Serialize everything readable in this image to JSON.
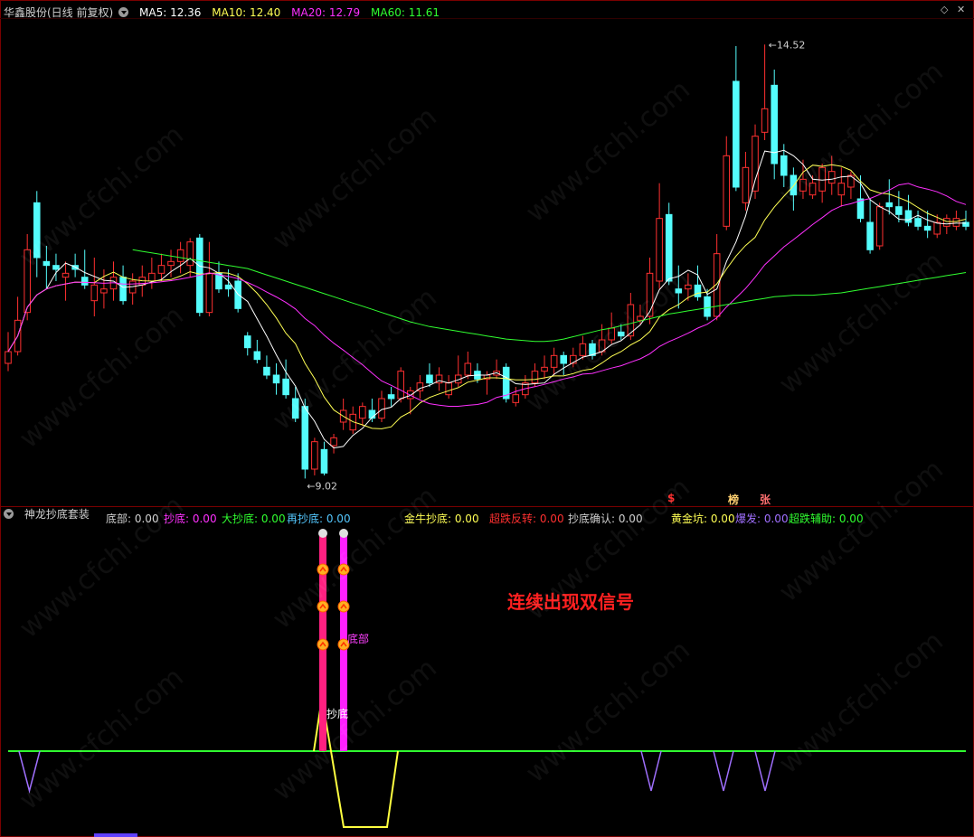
{
  "header": {
    "title": "华鑫股份(日线 前复权)",
    "ma5": "MA5: 12.36",
    "ma10": "MA10: 12.40",
    "ma20": "MA20: 12.79",
    "ma60": "MA60: 11.61"
  },
  "colors": {
    "up": "#ff3030",
    "down": "#54fcfc",
    "ma5": "#ffffff",
    "ma10": "#ffff54",
    "ma20": "#ff30ff",
    "ma60": "#30ff30",
    "grid": "#7a0000"
  },
  "main_annotations": {
    "high_label": "14.52",
    "low_label": "9.02"
  },
  "tags": {
    "dollar": "$",
    "bang": "榜",
    "zhang": "张"
  },
  "indicator": {
    "name": "神龙抄底套装",
    "dibu": "底部: 0.00",
    "chaodi": "抄底: 0.00",
    "dachaodi": "大抄底: 0.00",
    "zaichaodi": "再抄底: 0.00",
    "jinniu": "金牛抄底: 0.00",
    "chaodiefanzhuan": "超跌反转: 0.00",
    "chaodiquerren": "抄底确认: 0.00",
    "huangjinkeng": "黄金坑: 0.00",
    "baofa": "爆发: 0.00",
    "chaodiefuzhu": "超跌辅助: 0.00",
    "label_chaodi": "抄底",
    "label_dibu": "底部"
  },
  "note": "连续出现双信号",
  "watermark": "www.cfchi.com",
  "chart_data": {
    "type": "candlestick",
    "title": "华鑫股份(日线 前复权)",
    "ylim": [
      8.8,
      14.8
    ],
    "candles": [
      {
        "o": 10.45,
        "h": 10.85,
        "l": 10.35,
        "c": 10.6
      },
      {
        "o": 10.6,
        "h": 11.3,
        "l": 10.55,
        "c": 11.0
      },
      {
        "o": 11.1,
        "h": 12.1,
        "l": 11.0,
        "c": 11.9
      },
      {
        "o": 12.5,
        "h": 12.65,
        "l": 11.55,
        "c": 11.8
      },
      {
        "o": 11.75,
        "h": 11.95,
        "l": 11.4,
        "c": 11.7
      },
      {
        "o": 11.7,
        "h": 11.85,
        "l": 11.5,
        "c": 11.65
      },
      {
        "o": 11.55,
        "h": 11.75,
        "l": 11.25,
        "c": 11.6
      },
      {
        "o": 11.7,
        "h": 11.85,
        "l": 11.55,
        "c": 11.65
      },
      {
        "o": 11.55,
        "h": 11.9,
        "l": 11.4,
        "c": 11.45
      },
      {
        "o": 11.25,
        "h": 11.8,
        "l": 11.05,
        "c": 11.45
      },
      {
        "o": 11.35,
        "h": 11.65,
        "l": 11.15,
        "c": 11.4
      },
      {
        "o": 11.4,
        "h": 11.75,
        "l": 11.25,
        "c": 11.55
      },
      {
        "o": 11.55,
        "h": 11.7,
        "l": 11.2,
        "c": 11.25
      },
      {
        "o": 11.35,
        "h": 11.6,
        "l": 11.2,
        "c": 11.5
      },
      {
        "o": 11.45,
        "h": 11.7,
        "l": 11.3,
        "c": 11.55
      },
      {
        "o": 11.5,
        "h": 11.8,
        "l": 11.4,
        "c": 11.6
      },
      {
        "o": 11.6,
        "h": 11.85,
        "l": 11.5,
        "c": 11.7
      },
      {
        "o": 11.7,
        "h": 11.9,
        "l": 11.55,
        "c": 11.75
      },
      {
        "o": 11.75,
        "h": 12.0,
        "l": 11.6,
        "c": 11.9
      },
      {
        "o": 11.7,
        "h": 12.05,
        "l": 11.55,
        "c": 12.0
      },
      {
        "o": 12.05,
        "h": 12.1,
        "l": 11.05,
        "c": 11.1
      },
      {
        "o": 11.1,
        "h": 12.0,
        "l": 11.05,
        "c": 11.6
      },
      {
        "o": 11.6,
        "h": 11.75,
        "l": 11.35,
        "c": 11.4
      },
      {
        "o": 11.45,
        "h": 11.65,
        "l": 11.3,
        "c": 11.4
      },
      {
        "o": 11.5,
        "h": 11.6,
        "l": 11.1,
        "c": 11.15
      },
      {
        "o": 10.8,
        "h": 10.85,
        "l": 10.55,
        "c": 10.65
      },
      {
        "o": 10.6,
        "h": 10.75,
        "l": 10.45,
        "c": 10.5
      },
      {
        "o": 10.4,
        "h": 10.55,
        "l": 10.25,
        "c": 10.3
      },
      {
        "o": 10.3,
        "h": 10.45,
        "l": 10.05,
        "c": 10.2
      },
      {
        "o": 10.25,
        "h": 10.5,
        "l": 10.0,
        "c": 10.05
      },
      {
        "o": 10.0,
        "h": 10.15,
        "l": 9.7,
        "c": 9.75
      },
      {
        "o": 9.9,
        "h": 10.0,
        "l": 8.98,
        "c": 9.1
      },
      {
        "o": 9.1,
        "h": 9.5,
        "l": 9.02,
        "c": 9.45
      },
      {
        "o": 9.35,
        "h": 9.45,
        "l": 9.02,
        "c": 9.05
      },
      {
        "o": 9.4,
        "h": 9.55,
        "l": 9.3,
        "c": 9.5
      },
      {
        "o": 9.7,
        "h": 10.0,
        "l": 9.6,
        "c": 9.85
      },
      {
        "o": 9.6,
        "h": 9.9,
        "l": 9.55,
        "c": 9.8
      },
      {
        "o": 9.75,
        "h": 9.95,
        "l": 9.65,
        "c": 9.9
      },
      {
        "o": 9.85,
        "h": 10.0,
        "l": 9.7,
        "c": 9.75
      },
      {
        "o": 9.75,
        "h": 10.1,
        "l": 9.7,
        "c": 10.0
      },
      {
        "o": 10.05,
        "h": 10.15,
        "l": 9.9,
        "c": 10.0
      },
      {
        "o": 10.0,
        "h": 10.4,
        "l": 9.95,
        "c": 10.35
      },
      {
        "o": 10.0,
        "h": 10.15,
        "l": 9.8,
        "c": 10.1
      },
      {
        "o": 10.1,
        "h": 10.3,
        "l": 10.0,
        "c": 10.2
      },
      {
        "o": 10.3,
        "h": 10.45,
        "l": 10.15,
        "c": 10.2
      },
      {
        "o": 10.2,
        "h": 10.4,
        "l": 10.1,
        "c": 10.3
      },
      {
        "o": 10.05,
        "h": 10.3,
        "l": 10.0,
        "c": 10.2
      },
      {
        "o": 10.2,
        "h": 10.55,
        "l": 10.15,
        "c": 10.3
      },
      {
        "o": 10.3,
        "h": 10.6,
        "l": 10.25,
        "c": 10.45
      },
      {
        "o": 10.35,
        "h": 10.45,
        "l": 10.2,
        "c": 10.25
      },
      {
        "o": 10.25,
        "h": 10.35,
        "l": 10.05,
        "c": 10.3
      },
      {
        "o": 10.3,
        "h": 10.5,
        "l": 10.25,
        "c": 10.35
      },
      {
        "o": 10.4,
        "h": 10.45,
        "l": 9.95,
        "c": 10.0
      },
      {
        "o": 9.95,
        "h": 10.15,
        "l": 9.9,
        "c": 10.05
      },
      {
        "o": 10.05,
        "h": 10.3,
        "l": 10.0,
        "c": 10.2
      },
      {
        "o": 10.2,
        "h": 10.45,
        "l": 10.15,
        "c": 10.35
      },
      {
        "o": 10.35,
        "h": 10.55,
        "l": 10.25,
        "c": 10.4
      },
      {
        "o": 10.4,
        "h": 10.65,
        "l": 10.3,
        "c": 10.55
      },
      {
        "o": 10.55,
        "h": 10.6,
        "l": 10.3,
        "c": 10.45
      },
      {
        "o": 10.45,
        "h": 10.65,
        "l": 10.4,
        "c": 10.55
      },
      {
        "o": 10.55,
        "h": 10.8,
        "l": 10.5,
        "c": 10.7
      },
      {
        "o": 10.7,
        "h": 10.75,
        "l": 10.5,
        "c": 10.55
      },
      {
        "o": 10.6,
        "h": 10.95,
        "l": 10.55,
        "c": 10.75
      },
      {
        "o": 10.75,
        "h": 11.1,
        "l": 10.7,
        "c": 10.9
      },
      {
        "o": 10.85,
        "h": 10.95,
        "l": 10.75,
        "c": 10.8
      },
      {
        "o": 10.8,
        "h": 11.35,
        "l": 10.75,
        "c": 11.2
      },
      {
        "o": 11.0,
        "h": 11.2,
        "l": 10.95,
        "c": 11.05
      },
      {
        "o": 11.05,
        "h": 11.8,
        "l": 10.95,
        "c": 11.6
      },
      {
        "o": 11.5,
        "h": 12.75,
        "l": 11.4,
        "c": 12.3
      },
      {
        "o": 12.35,
        "h": 12.5,
        "l": 11.45,
        "c": 11.5
      },
      {
        "o": 11.4,
        "h": 11.7,
        "l": 11.15,
        "c": 11.35
      },
      {
        "o": 11.4,
        "h": 11.6,
        "l": 11.25,
        "c": 11.45
      },
      {
        "o": 11.45,
        "h": 11.7,
        "l": 11.25,
        "c": 11.3
      },
      {
        "o": 11.3,
        "h": 11.4,
        "l": 11.0,
        "c": 11.05
      },
      {
        "o": 11.05,
        "h": 12.1,
        "l": 11.0,
        "c": 11.85
      },
      {
        "o": 12.2,
        "h": 13.35,
        "l": 12.15,
        "c": 13.1
      },
      {
        "o": 14.05,
        "h": 14.5,
        "l": 12.65,
        "c": 12.7
      },
      {
        "o": 12.5,
        "h": 13.15,
        "l": 12.4,
        "c": 12.95
      },
      {
        "o": 12.65,
        "h": 13.5,
        "l": 12.55,
        "c": 13.35
      },
      {
        "o": 13.4,
        "h": 14.52,
        "l": 13.3,
        "c": 13.7
      },
      {
        "o": 14.0,
        "h": 14.2,
        "l": 12.8,
        "c": 13.0
      },
      {
        "o": 13.1,
        "h": 13.25,
        "l": 12.7,
        "c": 12.85
      },
      {
        "o": 12.85,
        "h": 12.95,
        "l": 12.4,
        "c": 12.6
      },
      {
        "o": 12.65,
        "h": 13.05,
        "l": 12.55,
        "c": 12.8
      },
      {
        "o": 12.6,
        "h": 12.85,
        "l": 12.55,
        "c": 12.75
      },
      {
        "o": 12.65,
        "h": 13.0,
        "l": 12.5,
        "c": 12.95
      },
      {
        "o": 12.75,
        "h": 13.1,
        "l": 12.6,
        "c": 12.9
      },
      {
        "o": 12.6,
        "h": 12.95,
        "l": 12.45,
        "c": 12.75
      },
      {
        "o": 12.7,
        "h": 12.9,
        "l": 12.55,
        "c": 12.85
      },
      {
        "o": 12.55,
        "h": 12.85,
        "l": 12.25,
        "c": 12.3
      },
      {
        "o": 12.25,
        "h": 12.55,
        "l": 11.85,
        "c": 11.9
      },
      {
        "o": 11.95,
        "h": 12.5,
        "l": 11.9,
        "c": 12.45
      },
      {
        "o": 12.5,
        "h": 12.8,
        "l": 12.35,
        "c": 12.45
      },
      {
        "o": 12.45,
        "h": 12.65,
        "l": 12.25,
        "c": 12.35
      },
      {
        "o": 12.4,
        "h": 12.6,
        "l": 12.2,
        "c": 12.25
      },
      {
        "o": 12.3,
        "h": 12.4,
        "l": 12.15,
        "c": 12.2
      },
      {
        "o": 12.2,
        "h": 12.4,
        "l": 12.05,
        "c": 12.15
      },
      {
        "o": 12.1,
        "h": 12.35,
        "l": 12.05,
        "c": 12.25
      },
      {
        "o": 12.2,
        "h": 12.35,
        "l": 12.1,
        "c": 12.3
      },
      {
        "o": 12.2,
        "h": 12.4,
        "l": 12.15,
        "c": 12.3
      },
      {
        "o": 12.25,
        "h": 12.4,
        "l": 12.15,
        "c": 12.2
      }
    ],
    "ma60": [
      11.9,
      11.88,
      11.86,
      11.84,
      11.82,
      11.8,
      11.78,
      11.76,
      11.74,
      11.72,
      11.7,
      11.68,
      11.66,
      11.62,
      11.58,
      11.54,
      11.5,
      11.46,
      11.42,
      11.38,
      11.34,
      11.3,
      11.26,
      11.22,
      11.18,
      11.14,
      11.1,
      11.06,
      11.02,
      10.98,
      10.95,
      10.92,
      10.9,
      10.88,
      10.86,
      10.84,
      10.82,
      10.8,
      10.78,
      10.76,
      10.75,
      10.74,
      10.73,
      10.73,
      10.74,
      10.76,
      10.79,
      10.82,
      10.85,
      10.88,
      10.9,
      10.93,
      10.96,
      10.99,
      11.02,
      11.05,
      11.08,
      11.1,
      11.12,
      11.14,
      11.16,
      11.18,
      11.2,
      11.22,
      11.24,
      11.26,
      11.28,
      11.3,
      11.31,
      11.32,
      11.32,
      11.32,
      11.33,
      11.34,
      11.35,
      11.37,
      11.39,
      11.41,
      11.43,
      11.45,
      11.47,
      11.49,
      11.51,
      11.53,
      11.55,
      11.57,
      11.59,
      11.61
    ],
    "x_label_low": "9.02",
    "x_label_high": "14.52"
  }
}
